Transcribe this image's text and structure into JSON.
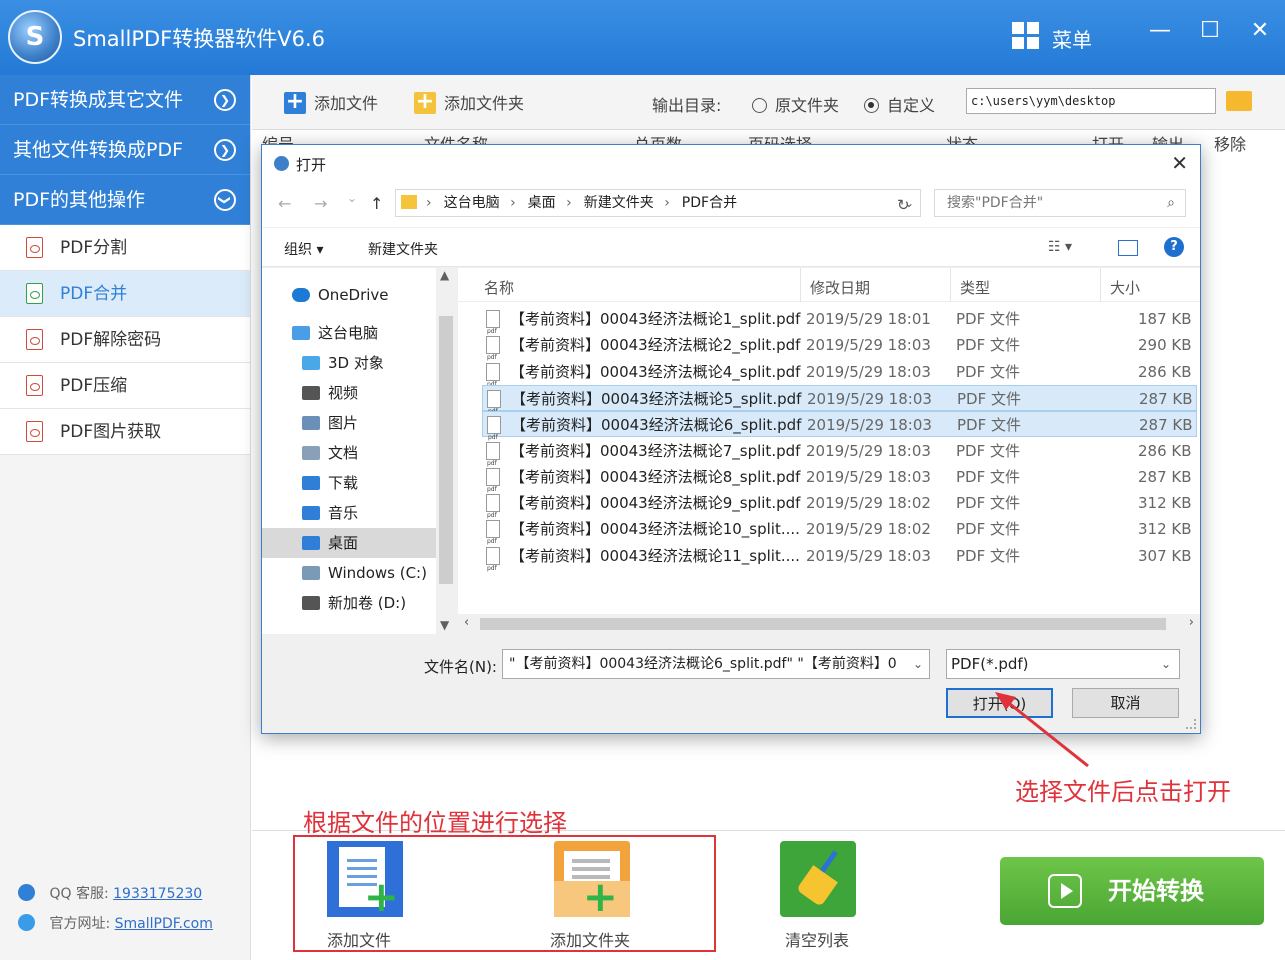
{
  "app": {
    "title": "SmallPDF转换器软件V6.6",
    "menu_label": "菜单",
    "logo_letter": "S",
    "window_controls": {
      "minimize": "—",
      "maximize": "☐",
      "close": "✕"
    }
  },
  "sidebar": {
    "categories": [
      {
        "label": "PDF转换成其它文件",
        "chevron": "❯"
      },
      {
        "label": "其他文件转换成PDF",
        "chevron": "❯"
      },
      {
        "label": "PDF的其他操作",
        "chevron": "❯"
      }
    ],
    "items": [
      {
        "label": "PDF分割",
        "active": false
      },
      {
        "label": "PDF合并",
        "active": true
      },
      {
        "label": "PDF解除密码",
        "active": false
      },
      {
        "label": "PDF压缩",
        "active": false
      },
      {
        "label": "PDF图片获取",
        "active": false
      }
    ],
    "contact": {
      "qq_label": "QQ 客服:",
      "qq_value": "1933175230",
      "site_label": "官方网址:",
      "site_value": "SmallPDF.com"
    }
  },
  "toolbar": {
    "add_file": "添加文件",
    "add_folder": "添加文件夹",
    "output_label": "输出目录:",
    "radio_original": "原文件夹",
    "radio_custom": "自定义",
    "output_path": "c:\\users\\yym\\desktop",
    "selected_radio": "custom"
  },
  "table_headers": [
    "编号",
    "文件名称",
    "总页数",
    "页码选择",
    "状态",
    "打开",
    "输出",
    "移除"
  ],
  "dialog": {
    "title": "打开",
    "close": "✕",
    "nav": {
      "back": "←",
      "forward": "→",
      "dropdown": "⌄",
      "up": "↑"
    },
    "breadcrumb": [
      "这台电脑",
      "桌面",
      "新建文件夹",
      "PDF合并"
    ],
    "refresh": "↻",
    "search_placeholder": "搜索\"PDF合并\"",
    "search_icon": "⌕",
    "organize": "组织 ▾",
    "new_folder": "新建文件夹",
    "view_icon": "☷ ▾",
    "help": "?",
    "nav_items": [
      {
        "label": "OneDrive",
        "icon": "cloud-icon",
        "color": "#1c7ad4",
        "selected": false
      },
      {
        "label": "这台电脑",
        "icon": "computer-icon",
        "color": "#4a9ee8",
        "selected": false
      },
      {
        "label": "3D 对象",
        "icon": "cube-icon",
        "color": "#4aa7e8",
        "selected": false
      },
      {
        "label": "视频",
        "icon": "video-icon",
        "color": "#555555",
        "selected": false
      },
      {
        "label": "图片",
        "icon": "image-icon",
        "color": "#6a8fb8",
        "selected": false
      },
      {
        "label": "文档",
        "icon": "document-icon",
        "color": "#8aa0b8",
        "selected": false
      },
      {
        "label": "下载",
        "icon": "download-icon",
        "color": "#2f7fd8",
        "selected": false
      },
      {
        "label": "音乐",
        "icon": "music-icon",
        "color": "#2f7fd8",
        "selected": false
      },
      {
        "label": "桌面",
        "icon": "desktop-icon",
        "color": "#2f7fd8",
        "selected": true
      },
      {
        "label": "Windows (C:)",
        "icon": "drive-c-icon",
        "color": "#7a9ab8",
        "selected": false
      },
      {
        "label": "新加卷 (D:)",
        "icon": "drive-d-icon",
        "color": "#555555",
        "selected": false
      }
    ],
    "columns": {
      "name": "名称",
      "modified": "修改日期",
      "type": "类型",
      "size": "大小"
    },
    "files": [
      {
        "name": "【考前资料】00043经济法概论1_split.pdf",
        "modified": "2019/5/29 18:01",
        "type": "PDF 文件",
        "size": "187 KB",
        "selected": false
      },
      {
        "name": "【考前资料】00043经济法概论2_split.pdf",
        "modified": "2019/5/29 18:03",
        "type": "PDF 文件",
        "size": "290 KB",
        "selected": false
      },
      {
        "name": "【考前资料】00043经济法概论4_split.pdf",
        "modified": "2019/5/29 18:03",
        "type": "PDF 文件",
        "size": "286 KB",
        "selected": false
      },
      {
        "name": "【考前资料】00043经济法概论5_split.pdf",
        "modified": "2019/5/29 18:03",
        "type": "PDF 文件",
        "size": "287 KB",
        "selected": true
      },
      {
        "name": "【考前资料】00043经济法概论6_split.pdf",
        "modified": "2019/5/29 18:03",
        "type": "PDF 文件",
        "size": "287 KB",
        "selected": true
      },
      {
        "name": "【考前资料】00043经济法概论7_split.pdf",
        "modified": "2019/5/29 18:03",
        "type": "PDF 文件",
        "size": "286 KB",
        "selected": false
      },
      {
        "name": "【考前资料】00043经济法概论8_split.pdf",
        "modified": "2019/5/29 18:03",
        "type": "PDF 文件",
        "size": "287 KB",
        "selected": false
      },
      {
        "name": "【考前资料】00043经济法概论9_split.pdf",
        "modified": "2019/5/29 18:02",
        "type": "PDF 文件",
        "size": "312 KB",
        "selected": false
      },
      {
        "name": "【考前资料】00043经济法概论10_split....",
        "modified": "2019/5/29 18:02",
        "type": "PDF 文件",
        "size": "312 KB",
        "selected": false
      },
      {
        "name": "【考前资料】00043经济法概论11_split....",
        "modified": "2019/5/29 18:03",
        "type": "PDF 文件",
        "size": "307 KB",
        "selected": false
      }
    ],
    "filename_label": "文件名(N):",
    "filename_value": "\"【考前资料】00043经济法概论6_split.pdf\" \"【考前资料】0",
    "filter_value": "PDF(*.pdf)",
    "open_button": "打开(O)",
    "cancel_button": "取消"
  },
  "bottom": {
    "add_file": "添加文件",
    "add_folder": "添加文件夹",
    "clear_list": "清空列表",
    "start": "开始转换"
  },
  "annotations": {
    "select_location": "根据文件的位置进行选择",
    "click_open": "选择文件后点击打开",
    "color": "#e0323a"
  }
}
